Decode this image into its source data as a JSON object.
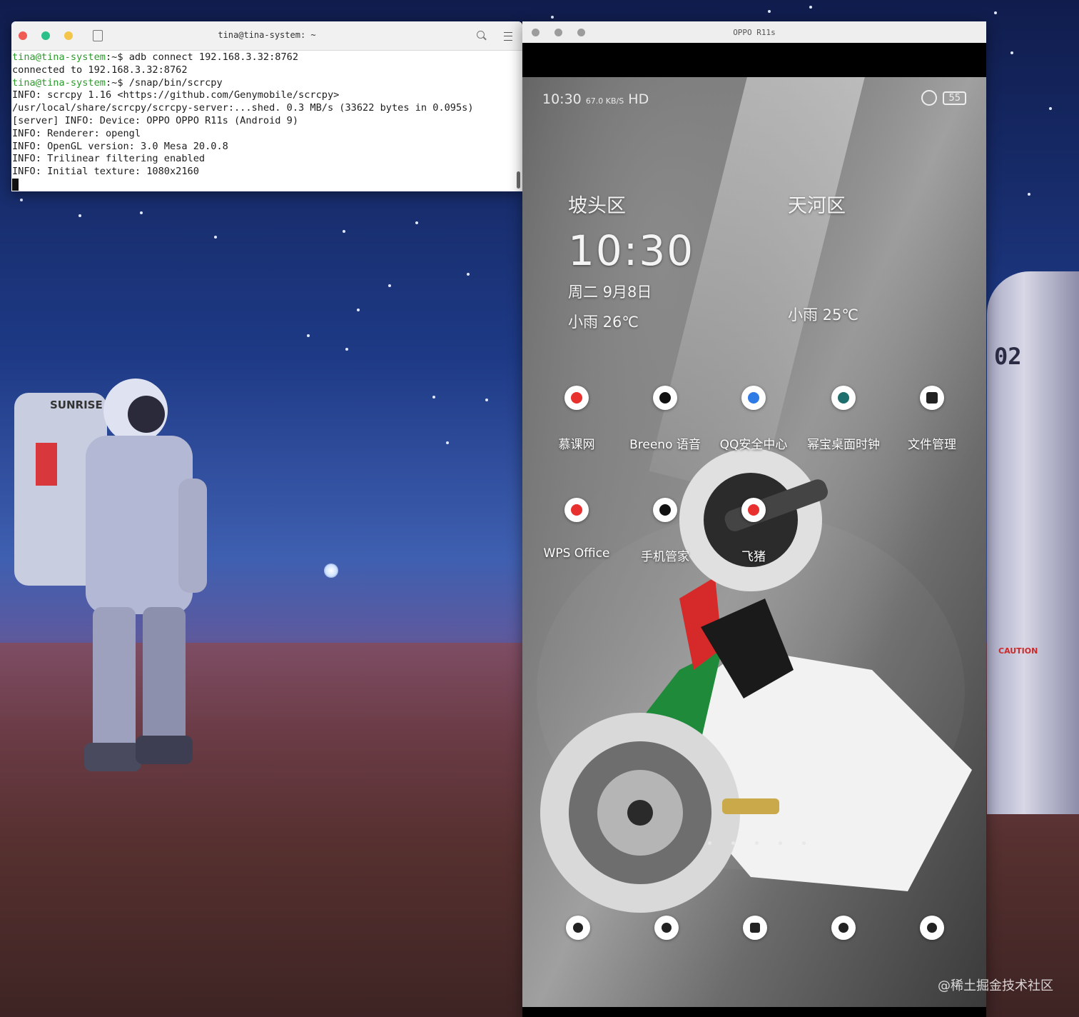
{
  "terminal": {
    "title": "tina@tina-system: ~",
    "lines": [
      {
        "prompt": "tina@tina-system",
        "rest": ":~$ adb connect 192.168.3.32:8762"
      },
      {
        "prompt": "",
        "rest": "connected to 192.168.3.32:8762"
      },
      {
        "prompt": "tina@tina-system",
        "rest": ":~$ /snap/bin/scrcpy"
      },
      {
        "prompt": "",
        "rest": "INFO: scrcpy 1.16 <https://github.com/Genymobile/scrcpy>"
      },
      {
        "prompt": "",
        "rest": "/usr/local/share/scrcpy/scrcpy-server:...shed. 0.3 MB/s (33622 bytes in 0.095s)"
      },
      {
        "prompt": "",
        "rest": "[server] INFO: Device: OPPO OPPO R11s (Android 9)"
      },
      {
        "prompt": "",
        "rest": "INFO: Renderer: opengl"
      },
      {
        "prompt": "",
        "rest": "INFO: OpenGL version: 3.0 Mesa 20.0.8"
      },
      {
        "prompt": "",
        "rest": "INFO: Trilinear filtering enabled"
      },
      {
        "prompt": "",
        "rest": "INFO: Initial texture: 1080x2160"
      }
    ]
  },
  "phone": {
    "window_title": "OPPO R11s",
    "status": {
      "time": "10:30",
      "net_speed": "67.0 KB/S",
      "hd": "HD",
      "battery": "55"
    },
    "clocks": [
      {
        "city": "坡头区",
        "time": "10:30",
        "date": "周二  9月8日",
        "weather": "小雨 26℃"
      },
      {
        "city": "天河区",
        "weather": "小雨 25℃"
      }
    ],
    "apps_row1": [
      {
        "label": "慕课网",
        "icon": "mooc-icon",
        "color": "#e8312f"
      },
      {
        "label": "Breeno 语音",
        "icon": "breeno-icon",
        "color": "#111111"
      },
      {
        "label": "QQ安全中心",
        "icon": "qq-security-icon",
        "color": "#2f7be6"
      },
      {
        "label": "幂宝桌面时钟",
        "icon": "desktop-clock-icon",
        "color": "#1f6e6e"
      },
      {
        "label": "文件管理",
        "icon": "file-manager-icon",
        "color": "#222222"
      }
    ],
    "apps_row2": [
      {
        "label": "WPS Office",
        "icon": "wps-icon",
        "color": "#e8312f"
      },
      {
        "label": "手机管家",
        "icon": "phone-manager-icon",
        "color": "#111111"
      },
      {
        "label": "飞猪",
        "icon": "fliggy-icon",
        "color": "#e8312f"
      }
    ],
    "dock": [
      {
        "icon": "phone-icon"
      },
      {
        "icon": "messages-icon"
      },
      {
        "icon": "camera-icon"
      },
      {
        "icon": "browser-icon"
      },
      {
        "icon": "wechat-icon"
      }
    ]
  },
  "desktop": {
    "rocket_text": "02",
    "rocket_caution": "CAUTION",
    "astronaut_text": "SUNRISE",
    "watermark": "@稀土掘金技术社区"
  }
}
